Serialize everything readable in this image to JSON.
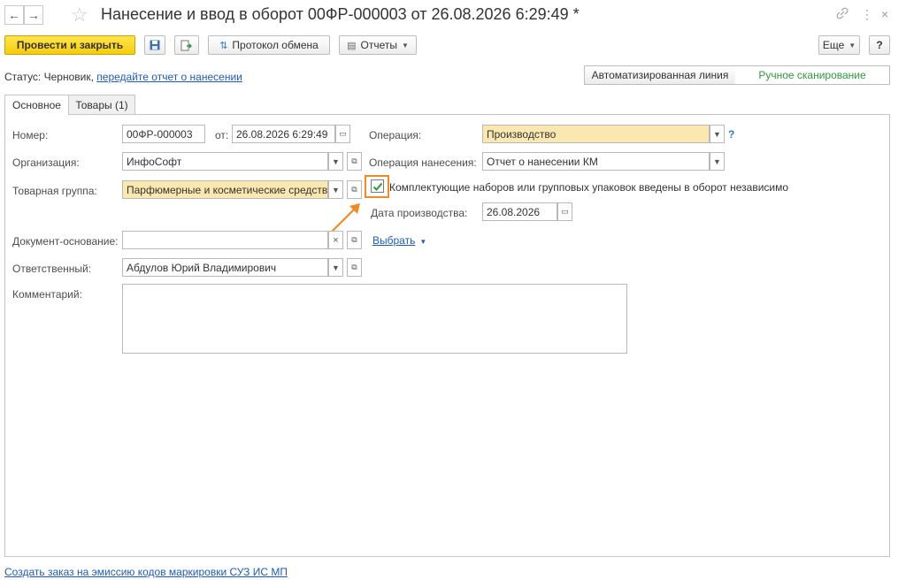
{
  "window": {
    "title": "Нанесение и ввод в оборот 00ФР-000003 от 26.08.2026 6:29:49 *",
    "back_glyph": "←",
    "forward_glyph": "→",
    "star_glyph": "☆",
    "link_glyph": "🔗",
    "menu_glyph": "⋮",
    "close_glyph": "×"
  },
  "toolbar": {
    "post_close_label": "Провести и закрыть",
    "save_glyph": "💾",
    "exchange_label": "Протокол обмена",
    "reports_label": "Отчеты",
    "more_label": "Еще",
    "help_label": "?",
    "colors": {
      "primary": "#f5cc0d",
      "accent": "#2c7ad0"
    }
  },
  "status": {
    "prefix": "Статус:",
    "value": "Черновик,",
    "link": "передайте отчет о нанесении"
  },
  "mode_switch": {
    "options": [
      "Автоматизированная линия",
      "Ручное сканирование"
    ],
    "selected": "Ручное сканирование"
  },
  "tabs": [
    {
      "label": "Основное",
      "active": true
    },
    {
      "label": "Товары (1)",
      "active": false
    }
  ],
  "form": {
    "number": {
      "label": "Номер:",
      "value": "00ФР-000003"
    },
    "date": {
      "label": "от:",
      "value": "26.08.2026  6:29:49"
    },
    "operation": {
      "label": "Операция:",
      "value": "Производство"
    },
    "organization": {
      "label": "Организация:",
      "value": "ИнфоСофт"
    },
    "marking_operation": {
      "label": "Операция нанесения:",
      "value": "Отчет о нанесении КМ"
    },
    "product_group": {
      "label": "Товарная группа:",
      "value": "Парфюмерные и косметические средств"
    },
    "components_checkbox": {
      "checked": true,
      "label": "Комплектующие наборов или групповых упаковок введены в оборот независимо"
    },
    "production_date": {
      "label": "Дата производства:",
      "value": "26.08.2026"
    },
    "base_document": {
      "label": "Документ-основание:",
      "value": "",
      "select_link": "Выбрать"
    },
    "responsible": {
      "label": "Ответственный:",
      "value": "Абдулов Юрий Владимирович"
    },
    "comment": {
      "label": "Комментарий:",
      "value": ""
    }
  },
  "footer": {
    "link": "Создать заказ на эмиссию кодов маркировки СУЗ ИС МП"
  },
  "annotation": {
    "color": "#f08a24"
  }
}
